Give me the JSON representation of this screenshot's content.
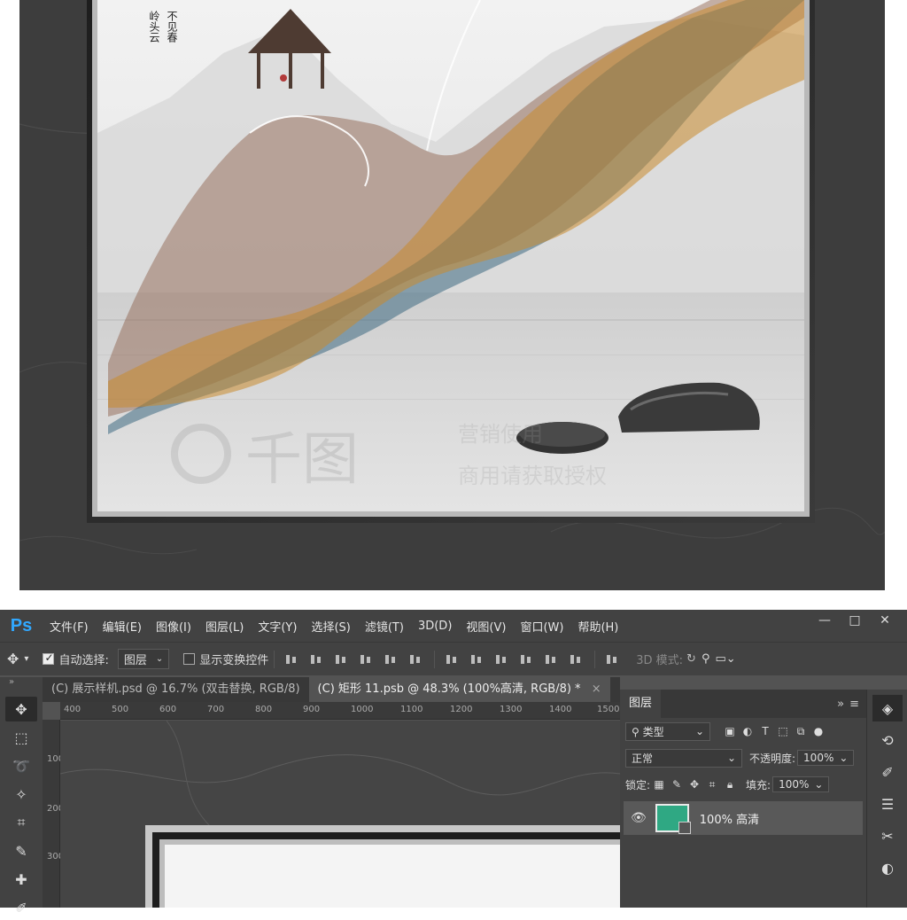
{
  "preview": {
    "poem_columns": [
      "岭头云",
      "不见春"
    ],
    "watermark": {
      "brand": "千图",
      "line1": "营销使用",
      "line2": "商用请获取授权"
    },
    "colors": {
      "wall": "#3e3e3e",
      "frame": "#2a2a2a",
      "mist": "#e9e9e9",
      "ribbon_brown": "#8a5a45",
      "ribbon_blue": "#2f5f7a",
      "ribbon_orange": "#c98a2e"
    }
  },
  "ps": {
    "logo": "Ps",
    "menus": [
      "文件(F)",
      "编辑(E)",
      "图像(I)",
      "图层(L)",
      "文字(Y)",
      "选择(S)",
      "滤镜(T)",
      "3D(D)",
      "视图(V)",
      "窗口(W)",
      "帮助(H)"
    ],
    "window_controls": [
      "—",
      "□",
      "✕"
    ],
    "options": {
      "move_icon": "move-icon",
      "auto_select_label": "自动选择:",
      "auto_select_checked": true,
      "auto_select_target": "图层",
      "show_transform_label": "显示变换控件",
      "show_transform_checked": false,
      "mode_3d_label": "3D 模式:"
    },
    "tabs": [
      {
        "label": "(C) 展示样机.psd @ 16.7% (双击替换, RGB/8)",
        "active": false
      },
      {
        "label": "(C) 矩形 11.psb @ 48.3% (100%高清, RGB/8) *",
        "active": true
      }
    ],
    "tab_close": "×",
    "panel_collapse": "»",
    "ruler_h": [
      "400",
      "500",
      "600",
      "700",
      "800",
      "900",
      "1000",
      "1100",
      "1200",
      "1300",
      "1400",
      "1500"
    ],
    "ruler_v": [
      "100",
      "200",
      "300"
    ],
    "tools": [
      "move-icon",
      "marquee-icon",
      "lasso-icon",
      "magic-wand-icon",
      "crop-icon",
      "eyedropper-icon",
      "healing-icon",
      "brush-icon"
    ],
    "layers": {
      "tab": "图层",
      "menu_glyph": "≡",
      "expand_glyph": "»",
      "filter_label": "类型",
      "filter_glyph": "⚲",
      "blend_mode": "正常",
      "opacity_label": "不透明度:",
      "opacity_value": "100%",
      "lock_label": "锁定:",
      "fill_label": "填充:",
      "fill_value": "100%",
      "layer": {
        "name": "100% 高清",
        "visible": true,
        "thumb_color": "#2fa883"
      }
    },
    "dock": [
      "layers-icon",
      "history-icon",
      "brush-presets-icon",
      "adjustments-icon",
      "tools-icon",
      "styles-icon"
    ]
  }
}
